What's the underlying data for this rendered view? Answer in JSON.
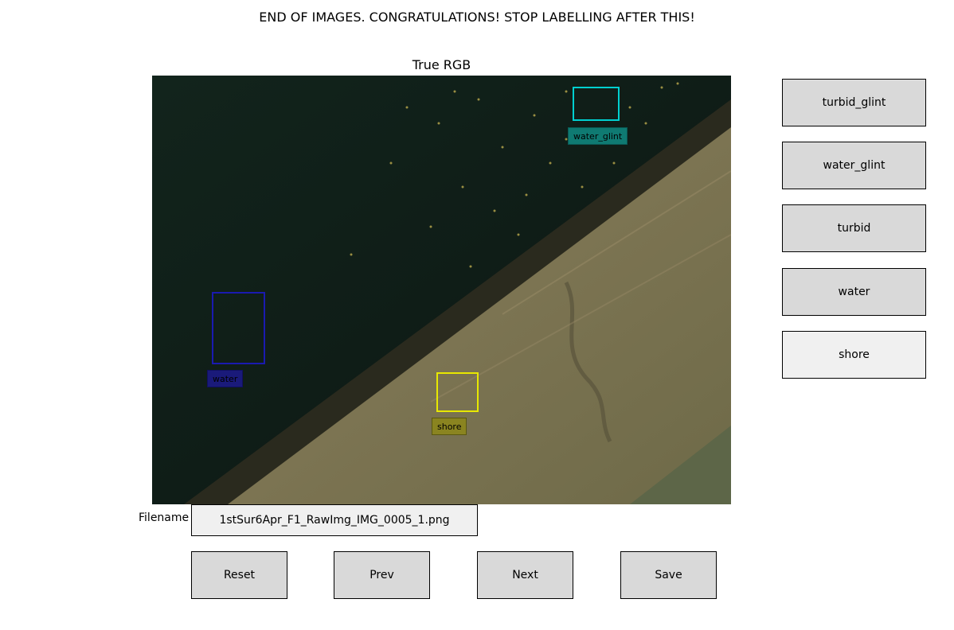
{
  "banner": "END OF IMAGES. CONGRATULATIONS! STOP LABELLING AFTER THIS!",
  "image_title": "True RGB",
  "label_buttons": [
    {
      "label": "turbid_glint"
    },
    {
      "label": "water_glint"
    },
    {
      "label": "turbid"
    },
    {
      "label": "water"
    },
    {
      "label": "shore",
      "selected": true
    }
  ],
  "annotations": [
    {
      "label": "water_glint",
      "color": "#00d0d0"
    },
    {
      "label": "water",
      "color": "#1a1ab0"
    },
    {
      "label": "shore",
      "color": "#e8e800"
    }
  ],
  "filename": {
    "label": "Filename",
    "value": "1stSur6Apr_F1_RawImg_IMG_0005_1.png"
  },
  "nav_buttons": {
    "reset": "Reset",
    "prev": "Prev",
    "next": "Next",
    "save": "Save"
  }
}
